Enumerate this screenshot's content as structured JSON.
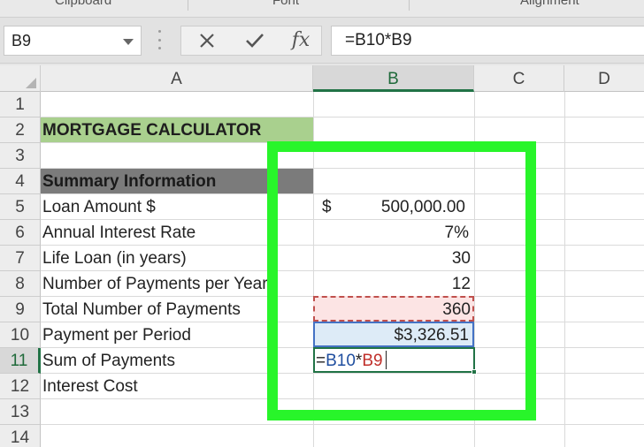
{
  "ribbon": {
    "groups": [
      {
        "label": "Clipboard"
      },
      {
        "label": "Font"
      },
      {
        "label": "Alignment"
      }
    ]
  },
  "formula_bar": {
    "name_box": "B9",
    "cancel_icon": "close-icon",
    "enter_icon": "check-icon",
    "function_icon": "fx-icon",
    "fx_label": "fx",
    "formula": "=B10*B9"
  },
  "columns": [
    "A",
    "B",
    "C",
    "D"
  ],
  "rows": [
    "1",
    "2",
    "3",
    "4",
    "5",
    "6",
    "7",
    "8",
    "9",
    "10",
    "11",
    "12",
    "13",
    "14"
  ],
  "cells": {
    "a2": "MORTGAGE CALCULATOR",
    "a4": "Summary Information",
    "a5": "Loan Amount $",
    "a6": "Annual Interest Rate",
    "a7": "Life Loan (in years)",
    "a8": "Number of Payments per Year",
    "a9": "Total Number of Payments",
    "a10": "Payment per Period",
    "a11": "Sum of Payments",
    "a12": "Interest Cost",
    "b5_currency": "$",
    "b5_value": "500,000.00",
    "b6": "7%",
    "b7": "30",
    "b8": "12",
    "b9": "360",
    "b10": "$3,326.51",
    "b11_prefix": "=",
    "b11_ref1": "B10",
    "b11_op": "*",
    "b11_ref2": "B9"
  },
  "colors": {
    "header_fill": "#a9d08e",
    "summary_fill": "#7b7b7b",
    "excel_green": "#217346",
    "annotation_green": "#28f52a"
  }
}
